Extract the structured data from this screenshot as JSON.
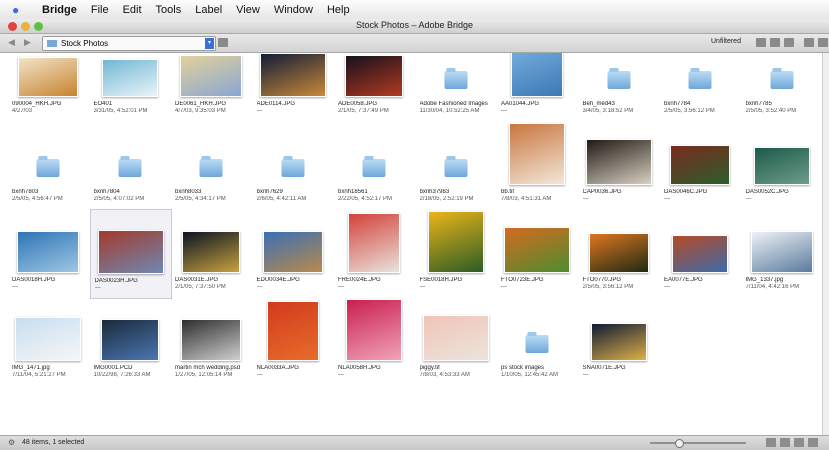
{
  "menubar": {
    "items": [
      "Bridge",
      "File",
      "Edit",
      "Tools",
      "Label",
      "View",
      "Window",
      "Help"
    ]
  },
  "window": {
    "title": "Stock Photos – Adobe Bridge"
  },
  "toolbar": {
    "location": "Stock Photos",
    "sort_label": "Unfiltered"
  },
  "status": {
    "text": "48 items, 1 selected"
  },
  "zoom": {
    "level": 0.3
  },
  "items": [
    {
      "name": "090004_HKH.JPG",
      "date": "4/27/03",
      "kind": "photo",
      "colors": [
        "#f1e4c7",
        "#c7822f"
      ]
    },
    {
      "name": "EO401",
      "date": "3/31/05, 4:52:01 PM",
      "kind": "photo",
      "colors": [
        "#72b6d4",
        "#eaf4f8"
      ]
    },
    {
      "name": "DE0061_HKH.JPG",
      "date": "4/7/03, 9:35:03 PM",
      "kind": "photo",
      "colors": [
        "#e2d19b",
        "#8aa6d2"
      ]
    },
    {
      "name": "ADE0114.JPG",
      "date": "—",
      "kind": "photo",
      "colors": [
        "#111c38",
        "#c98938"
      ]
    },
    {
      "name": "ADE0058.JPG",
      "date": "2/1/05, 7:37:49 PM",
      "kind": "photo",
      "colors": [
        "#16101b",
        "#b33a22"
      ]
    },
    {
      "name": "Adobe Fashioned Images",
      "date": "11/30/04, 10:52:25 AM",
      "kind": "folder"
    },
    {
      "name": "AA01044.JPG",
      "date": "—",
      "kind": "photo",
      "colors": [
        "#7fb7e3",
        "#3c78b5"
      ]
    },
    {
      "name": "Beh_med43",
      "date": "3/4/05, 3:18:52 PM",
      "kind": "folder"
    },
    {
      "name": "bxnh7784",
      "date": "2/5/05, 3:56:12 PM",
      "kind": "folder"
    },
    {
      "name": "bxnh7785",
      "date": "2/5/05, 3:52:40 PM",
      "kind": "folder"
    },
    {
      "name": "bxnh7803",
      "date": "2/5/05, 4:56:47 PM",
      "kind": "folder"
    },
    {
      "name": "bxnh7804",
      "date": "2/5/05, 4:07:02 PM",
      "kind": "folder"
    },
    {
      "name": "bxnh8033",
      "date": "2/5/05, 4:34:17 PM",
      "kind": "folder"
    },
    {
      "name": "bxnh7629",
      "date": "2/6/05, 4:42:11 AM",
      "kind": "folder"
    },
    {
      "name": "bxnh18561",
      "date": "2/22/05, 4:52:17 PM",
      "kind": "folder"
    },
    {
      "name": "bxnh37983",
      "date": "2/18/05, 2:52:19 PM",
      "kind": "folder"
    },
    {
      "name": "bb.tif",
      "date": "7/8/03, 4:51:31 AM",
      "kind": "photo",
      "colors": [
        "#c8763e",
        "#f3e7da"
      ]
    },
    {
      "name": "CAP0036.JPG",
      "date": "—",
      "kind": "photo",
      "colors": [
        "#1f1a14",
        "#d9d0c2"
      ]
    },
    {
      "name": "DAS0046C.JPG",
      "date": "—",
      "kind": "photo",
      "colors": [
        "#7a2a1e",
        "#2c5e2b"
      ]
    },
    {
      "name": "DAS0052C.JPG",
      "date": "—",
      "kind": "photo",
      "colors": [
        "#1d5a4a",
        "#6d9d88"
      ]
    },
    {
      "name": "DAS0018H.JPG",
      "date": "—",
      "kind": "photo",
      "colors": [
        "#2e74b6",
        "#9ec7e4"
      ]
    },
    {
      "name": "DAS0023H.JPG",
      "date": "—",
      "kind": "photo",
      "colors": [
        "#a33a2b",
        "#6e88b4"
      ]
    },
    {
      "name": "DAS0031E.JPG",
      "date": "2/1/05, 7:37:50 PM",
      "kind": "photo",
      "colors": [
        "#0a1222",
        "#c8a23e"
      ]
    },
    {
      "name": "EDU0034E.JPG",
      "date": "—",
      "kind": "photo",
      "colors": [
        "#3b6fb4",
        "#b88a4b"
      ]
    },
    {
      "name": "FRE0024E.JPG",
      "date": "—",
      "kind": "photo",
      "colors": [
        "#d3423a",
        "#e9e2dc"
      ]
    },
    {
      "name": "FSE0018H.JPG",
      "date": "—",
      "kind": "photo",
      "colors": [
        "#ecb419",
        "#2b5c25"
      ]
    },
    {
      "name": "FTO0723E.JPG",
      "date": "—",
      "kind": "photo",
      "colors": [
        "#d46a21",
        "#4d8d2f"
      ]
    },
    {
      "name": "FTO0770.JPG",
      "date": "2/5/05, 3:56:12 PM",
      "kind": "photo",
      "colors": [
        "#e07620",
        "#1e2a12"
      ]
    },
    {
      "name": "EA0077E.JPG",
      "date": "—",
      "kind": "photo",
      "colors": [
        "#b64a27",
        "#3c6aa8"
      ]
    },
    {
      "name": "IMG_1337.jpg",
      "date": "7/11/04, 4:42:16 PM",
      "kind": "photo",
      "colors": [
        "#eef2f6",
        "#5a7a9e"
      ]
    },
    {
      "name": "IMG_1471.jpg",
      "date": "7/11/04, 5:21:27 PM",
      "kind": "photo",
      "colors": [
        "#c7def1",
        "#f6f6f6"
      ]
    },
    {
      "name": "IMG0001.PCD",
      "date": "10/22/98, 7:26:33 AM",
      "kind": "photo",
      "colors": [
        "#1b2a3c",
        "#4a76b4"
      ]
    },
    {
      "name": "martin mch wedding.psd",
      "date": "1/27/05, 12:05:14 PM",
      "kind": "photo",
      "colors": [
        "#2e2e2e",
        "#cfcfcf"
      ]
    },
    {
      "name": "NLA0033A.JPG",
      "date": "—",
      "kind": "photo",
      "colors": [
        "#d23a1e",
        "#e66d2a"
      ]
    },
    {
      "name": "NLA0058H.JPG",
      "date": "—",
      "kind": "photo",
      "colors": [
        "#c91f4e",
        "#f0a3ba"
      ]
    },
    {
      "name": "piggy.tif",
      "date": "7/8/03, 4:53:33 AM",
      "kind": "photo",
      "colors": [
        "#f1c4b7",
        "#ece4dc"
      ]
    },
    {
      "name": "ps stock images",
      "date": "1/10/05, 12:45:42 AM",
      "kind": "folder"
    },
    {
      "name": "SNA0071E.JPG",
      "date": "—",
      "kind": "photo",
      "colors": [
        "#0d1b35",
        "#e0b048"
      ]
    }
  ]
}
